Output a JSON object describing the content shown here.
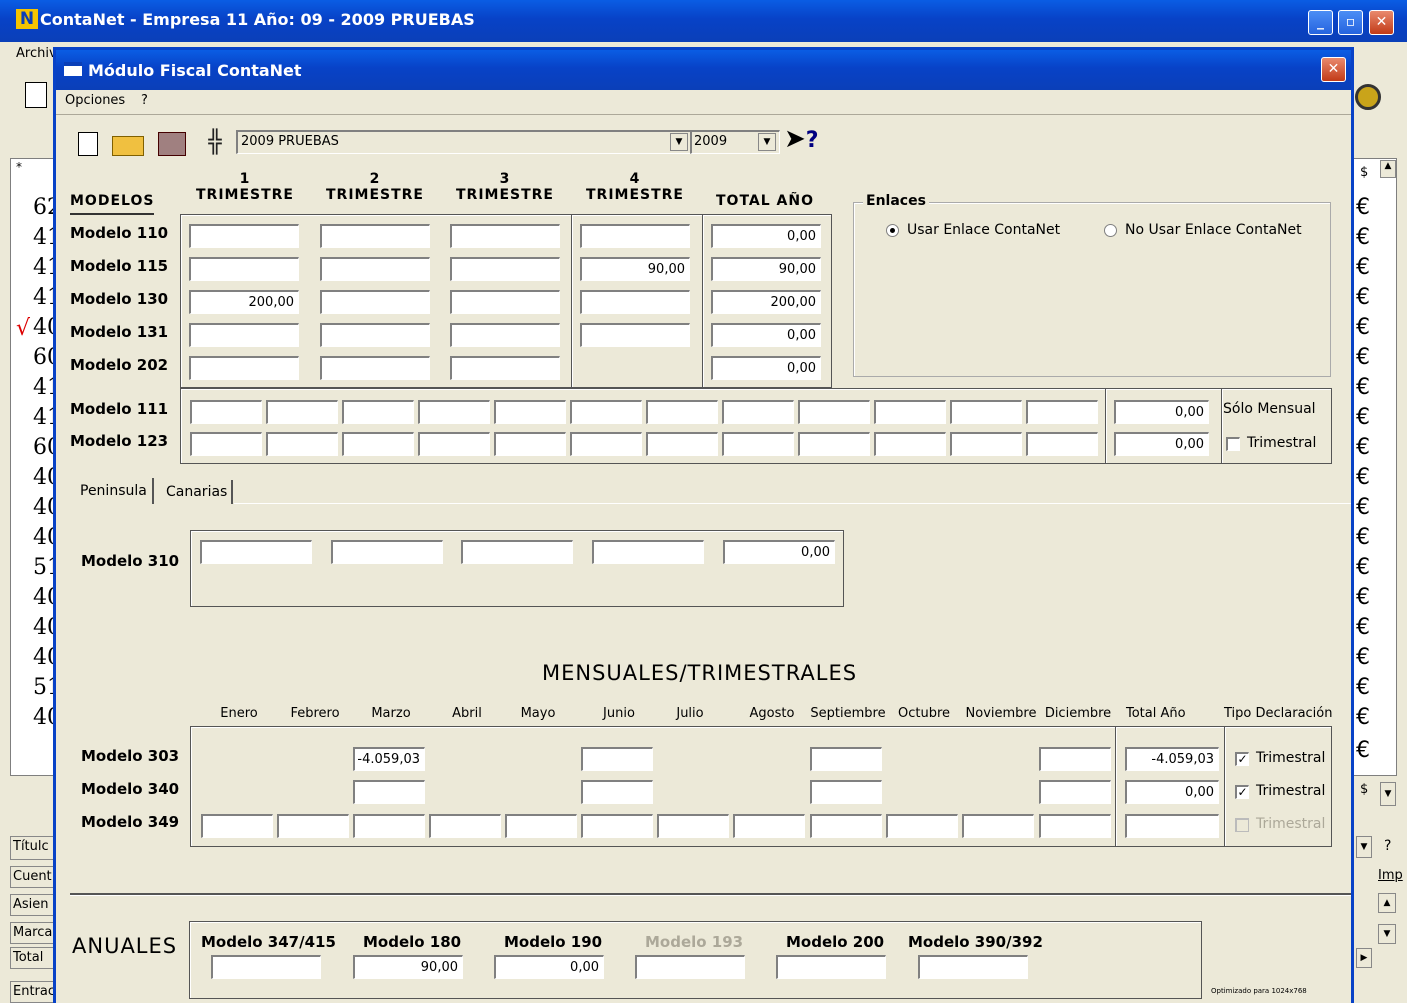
{
  "outer_window": {
    "title": "ContaNet - Empresa 11  Año: 09 - 2009 PRUEBAS",
    "logo": "N",
    "menu_first": "Archiv",
    "bg_numbers": [
      "62",
      "41",
      "41",
      "41",
      "40",
      "60",
      "41",
      "41",
      "60",
      "40",
      "40",
      "40",
      "51",
      "40",
      "40",
      "40",
      "51",
      "40"
    ],
    "check_mark": "√",
    "euro": "€",
    "dollar": "$",
    "left_labels": [
      "Títulc",
      "Cuent",
      "Asien",
      "Marca",
      "Total",
      "Entrac"
    ],
    "right_label": "Imp",
    "help": "?"
  },
  "window": {
    "title": "Módulo Fiscal ContaNet",
    "menu": [
      "Opciones",
      "?"
    ],
    "empresa_select": "2009 PRUEBAS",
    "year_select": "2009",
    "icons": [
      "new-file-icon",
      "open-folder-icon",
      "print-icon",
      "settings-icon",
      "help-pointer-icon"
    ]
  },
  "quarterly": {
    "header_models": "MODELOS",
    "headers": [
      {
        "num": "1",
        "label": "TRIMESTRE"
      },
      {
        "num": "2",
        "label": "TRIMESTRE"
      },
      {
        "num": "3",
        "label": "TRIMESTRE"
      },
      {
        "num": "4",
        "label": "TRIMESTRE"
      }
    ],
    "total_label": "TOTAL AÑO",
    "rows": [
      {
        "label": "Modelo 110",
        "q": [
          "",
          "",
          "",
          ""
        ],
        "total": "0,00"
      },
      {
        "label": "Modelo 115",
        "q": [
          "",
          "",
          "",
          "90,00"
        ],
        "total": "90,00"
      },
      {
        "label": "Modelo 130",
        "q": [
          "200,00",
          "",
          "",
          ""
        ],
        "total": "200,00"
      },
      {
        "label": "Modelo 131",
        "q": [
          "",
          "",
          "",
          ""
        ],
        "total": "0,00"
      },
      {
        "label": "Modelo 202",
        "q": [
          "",
          "",
          ""
        ],
        "total": "0,00"
      }
    ]
  },
  "enlaces": {
    "title": "Enlaces",
    "option_yes": "Usar Enlace ContaNet",
    "option_no": "No Usar Enlace ContaNet",
    "selected": "yes"
  },
  "monthly_111": {
    "rows": [
      {
        "label": "Modelo 111",
        "total": "0,00"
      },
      {
        "label": "Modelo 123",
        "total": "0,00"
      }
    ],
    "solo_mensual": "Sólo Mensual",
    "trimestral_label": "Trimestral"
  },
  "tabs": [
    "Peninsula",
    "Canarias"
  ],
  "modelo_310": {
    "label": "Modelo 310",
    "fields": [
      "",
      "",
      "",
      ""
    ],
    "total": "0,00"
  },
  "mensuales": {
    "title": "MENSUALES/TRIMESTRALES",
    "months": [
      "Enero",
      "Febrero",
      "Marzo",
      "Abril",
      "Mayo",
      "Junio",
      "Julio",
      "Agosto",
      "Septiembre",
      "Octubre",
      "Noviembre",
      "Diciembre"
    ],
    "total_label": "Total Año",
    "tipo_label": "Tipo Declaración",
    "rows": [
      {
        "label": "Modelo 303",
        "marzo": "-4.059,03",
        "total": "-4.059,03",
        "tipo": "Trimestral"
      },
      {
        "label": "Modelo 340",
        "marzo": "",
        "total": "0,00",
        "tipo": "Trimestral"
      },
      {
        "label": "Modelo 349",
        "marzo": "",
        "total": "",
        "tipo": "Trimestral"
      }
    ]
  },
  "anuales": {
    "title": "ANUALES",
    "models": [
      {
        "label": "Modelo 347/415",
        "value": ""
      },
      {
        "label": "Modelo 180",
        "value": "90,00"
      },
      {
        "label": "Modelo 190",
        "value": "0,00"
      },
      {
        "label": "Modelo 193",
        "value": ""
      },
      {
        "label": "Modelo 200",
        "value": ""
      },
      {
        "label": "Modelo 390/392",
        "value": ""
      }
    ],
    "footnote": "Optimizado para 1024x768"
  }
}
